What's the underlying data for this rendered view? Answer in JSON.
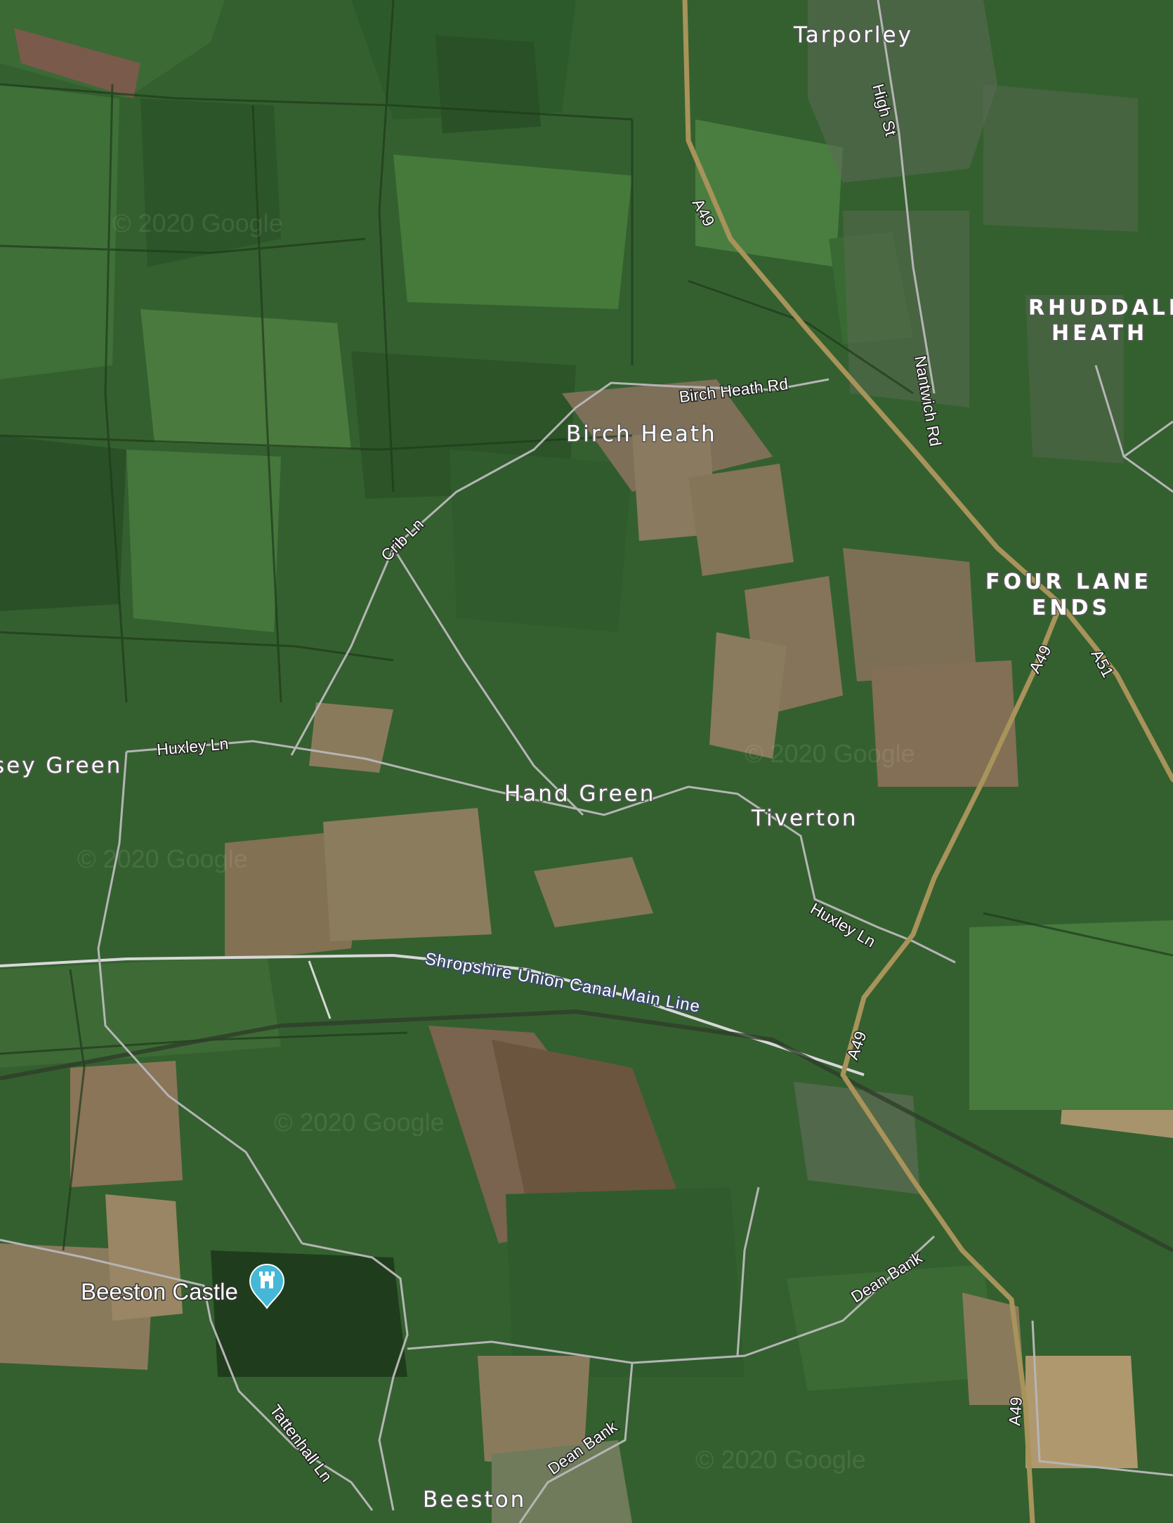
{
  "map": {
    "type": "satellite",
    "places": {
      "tarporley": "Tarporley",
      "rhuddall_1": "RHUDDALL",
      "rhuddall_2": "HEATH",
      "birch_heath": "Birch Heath",
      "four_lane_1": "FOUR LANE",
      "four_lane_2": "ENDS",
      "hand_green": "Hand Green",
      "tiverton": "Tiverton",
      "sey_green": "sey Green",
      "beeston": "Beeston"
    },
    "roads": {
      "a49_top": "A49",
      "a49_mid": "A49",
      "a49_canal": "A49",
      "a49_bottom": "A49",
      "a51": "A51",
      "high_st": "High St",
      "nantwich_rd": "Nantwich Rd",
      "birch_heath_rd": "Birch Heath Rd",
      "crib_ln": "Crib Ln",
      "huxley_ln_w": "Huxley Ln",
      "huxley_ln_e": "Huxley Ln",
      "dean_bank_e": "Dean Bank",
      "dean_bank_s": "Dean Bank",
      "tattenhall_ln": "Tattenhall Ln"
    },
    "waterway": "Shropshire Union Canal Main Line",
    "poi": {
      "label": "Beeston Castle",
      "icon": "castle-pin-icon"
    },
    "watermarks": [
      "© 2020 Google",
      "© 2020 Google",
      "© 2020 Google",
      "© 2020 Google",
      "© 2020 Google"
    ],
    "colors": {
      "field_dark": "#2f5a2c",
      "field_mid": "#3f6e36",
      "field_light": "#507e41",
      "field_brown": "#6f6a4e",
      "a_road": "#a8935a",
      "minor_road": "#b5b5b5",
      "canal": "#d8d8d8",
      "pin": "#44b8d6"
    }
  }
}
